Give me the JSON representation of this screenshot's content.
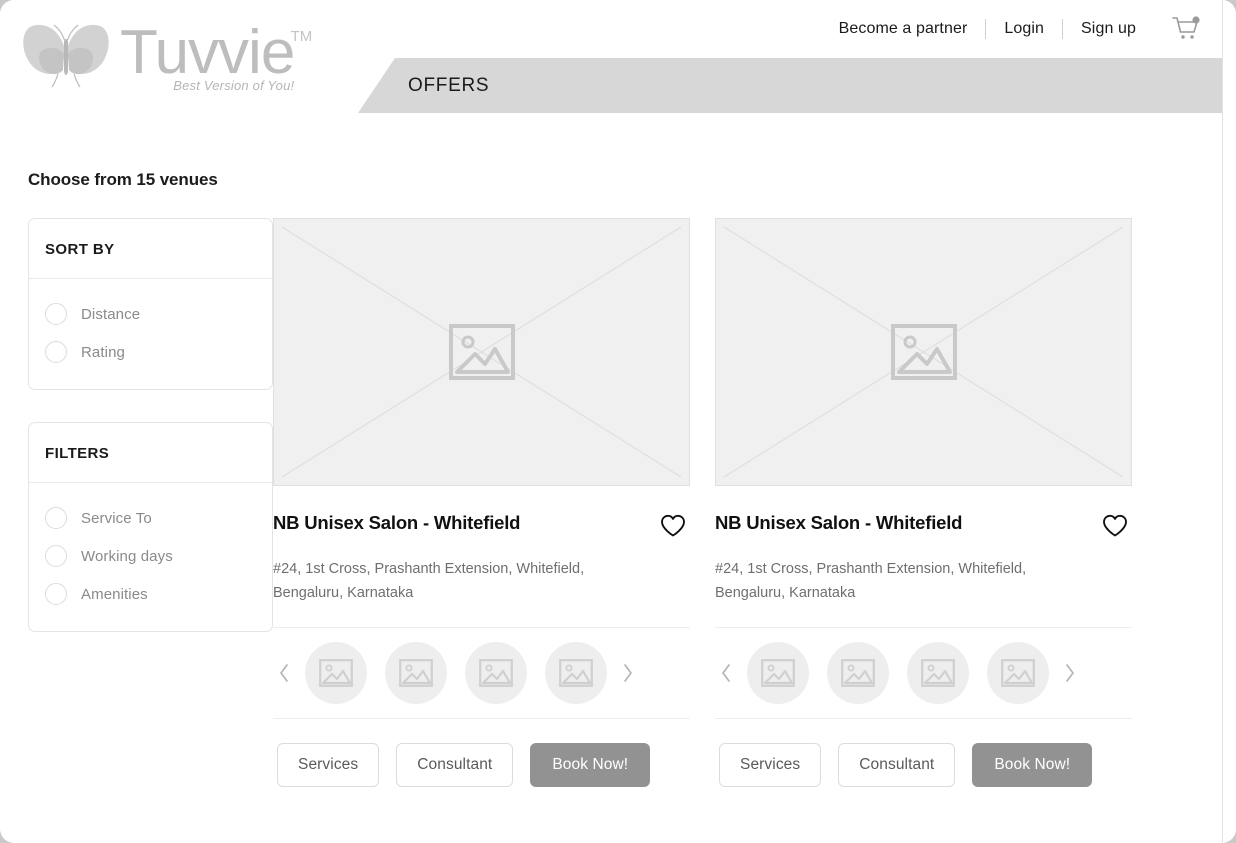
{
  "brand": {
    "name": "Tuvvie",
    "trademark": "TM",
    "tagline": "Best Version of You!",
    "logo_icon": "butterfly-icon",
    "wordmark_color": "#bdbdbd"
  },
  "topnav": {
    "links": [
      {
        "label": "Become a partner"
      },
      {
        "label": "Login"
      },
      {
        "label": "Sign up"
      }
    ],
    "cart_icon": "shopping-cart-icon",
    "cart_badge": true
  },
  "banner": {
    "title": "OFFERS",
    "background": "#d7d7d7"
  },
  "results": {
    "heading": "Choose from 15 venues",
    "count": 15
  },
  "sidebar": {
    "cards": [
      {
        "title": "SORT BY",
        "options": [
          {
            "label": "Distance",
            "selected": false
          },
          {
            "label": "Rating",
            "selected": false
          }
        ]
      },
      {
        "title": "FILTERS",
        "options": [
          {
            "label": "Service To",
            "selected": false
          },
          {
            "label": "Working days",
            "selected": false
          },
          {
            "label": "Amenities",
            "selected": false
          }
        ]
      }
    ]
  },
  "venues": [
    {
      "name": "NB Unisex Salon - Whitefield",
      "address": "#24, 1st Cross, Prashanth Extension, Whitefield, Bengaluru, Karnataka",
      "favorite": false,
      "photo_placeholder": "image-placeholder-icon",
      "thumbnails": [
        {
          "placeholder": "image-placeholder-icon"
        },
        {
          "placeholder": "image-placeholder-icon"
        },
        {
          "placeholder": "image-placeholder-icon"
        },
        {
          "placeholder": "image-placeholder-icon"
        }
      ],
      "actions": [
        {
          "label": "Services",
          "style": "outline"
        },
        {
          "label": "Consultant",
          "style": "outline"
        },
        {
          "label": "Book Now!",
          "style": "primary"
        }
      ]
    },
    {
      "name": "NB Unisex Salon - Whitefield",
      "address": "#24, 1st Cross, Prashanth Extension, Whitefield, Bengaluru, Karnataka",
      "favorite": false,
      "photo_placeholder": "image-placeholder-icon",
      "thumbnails": [
        {
          "placeholder": "image-placeholder-icon"
        },
        {
          "placeholder": "image-placeholder-icon"
        },
        {
          "placeholder": "image-placeholder-icon"
        },
        {
          "placeholder": "image-placeholder-icon"
        }
      ],
      "actions": [
        {
          "label": "Services",
          "style": "outline"
        },
        {
          "label": "Consultant",
          "style": "outline"
        },
        {
          "label": "Book Now!",
          "style": "primary"
        }
      ]
    }
  ],
  "colors": {
    "primary_button": "#929292",
    "banner": "#d7d7d7",
    "text_dark": "#1b1b1b",
    "text_muted": "#8a8a8a"
  }
}
